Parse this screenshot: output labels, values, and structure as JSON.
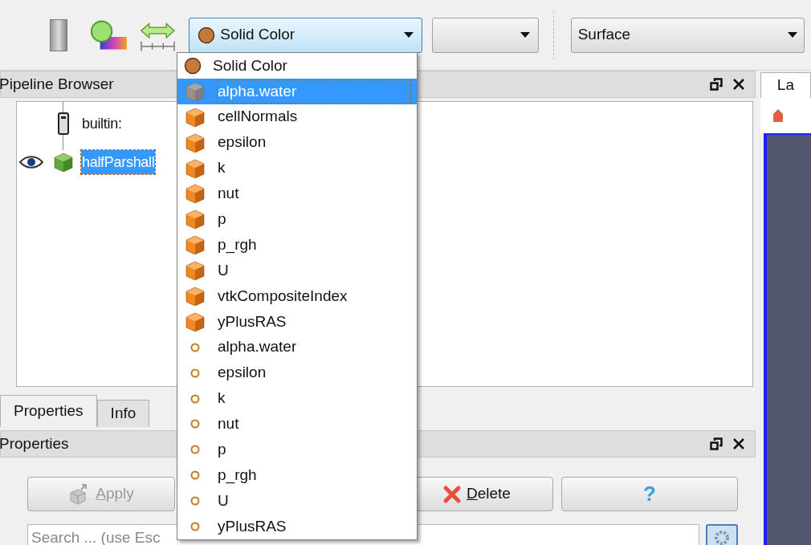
{
  "toolbar": {
    "color_combo": {
      "value": "Solid Color",
      "open": true
    },
    "representation_combo": {
      "value": "Surface"
    }
  },
  "color_menu": [
    {
      "kind": "solid",
      "label": "Solid Color",
      "selected": false
    },
    {
      "kind": "cell",
      "label": "alpha.water",
      "selected": true
    },
    {
      "kind": "cell",
      "label": "cellNormals",
      "selected": false
    },
    {
      "kind": "cell",
      "label": "epsilon",
      "selected": false
    },
    {
      "kind": "cell",
      "label": "k",
      "selected": false
    },
    {
      "kind": "cell",
      "label": "nut",
      "selected": false
    },
    {
      "kind": "cell",
      "label": "p",
      "selected": false
    },
    {
      "kind": "cell",
      "label": "p_rgh",
      "selected": false
    },
    {
      "kind": "cell",
      "label": "U",
      "selected": false
    },
    {
      "kind": "cell",
      "label": "vtkCompositeIndex",
      "selected": false
    },
    {
      "kind": "cell",
      "label": "yPlusRAS",
      "selected": false
    },
    {
      "kind": "point",
      "label": "alpha.water",
      "selected": false
    },
    {
      "kind": "point",
      "label": "epsilon",
      "selected": false
    },
    {
      "kind": "point",
      "label": "k",
      "selected": false
    },
    {
      "kind": "point",
      "label": "nut",
      "selected": false
    },
    {
      "kind": "point",
      "label": "p",
      "selected": false
    },
    {
      "kind": "point",
      "label": "p_rgh",
      "selected": false
    },
    {
      "kind": "point",
      "label": "U",
      "selected": false
    },
    {
      "kind": "point",
      "label": "yPlusRAS",
      "selected": false
    }
  ],
  "pipeline_browser": {
    "title": "Pipeline Browser",
    "items": [
      {
        "kind": "server",
        "label": "builtin:",
        "selected": false,
        "visible": false
      },
      {
        "kind": "source",
        "label": "halfParshall",
        "selected": true,
        "visible": true
      }
    ]
  },
  "tabs": [
    {
      "label": "Properties",
      "selected": true
    },
    {
      "label": "Info",
      "selected": false
    }
  ],
  "properties_panel": {
    "title": "Properties",
    "buttons": [
      {
        "kind": "apply",
        "label": "Apply",
        "disabled": true
      },
      {
        "kind": "delete",
        "label": "Delete",
        "disabled": false
      },
      {
        "kind": "help",
        "label": "?",
        "disabled": false
      }
    ],
    "search": {
      "placeholder": "Search ... (use Esc"
    }
  },
  "right_panel": {
    "tab": "La"
  }
}
